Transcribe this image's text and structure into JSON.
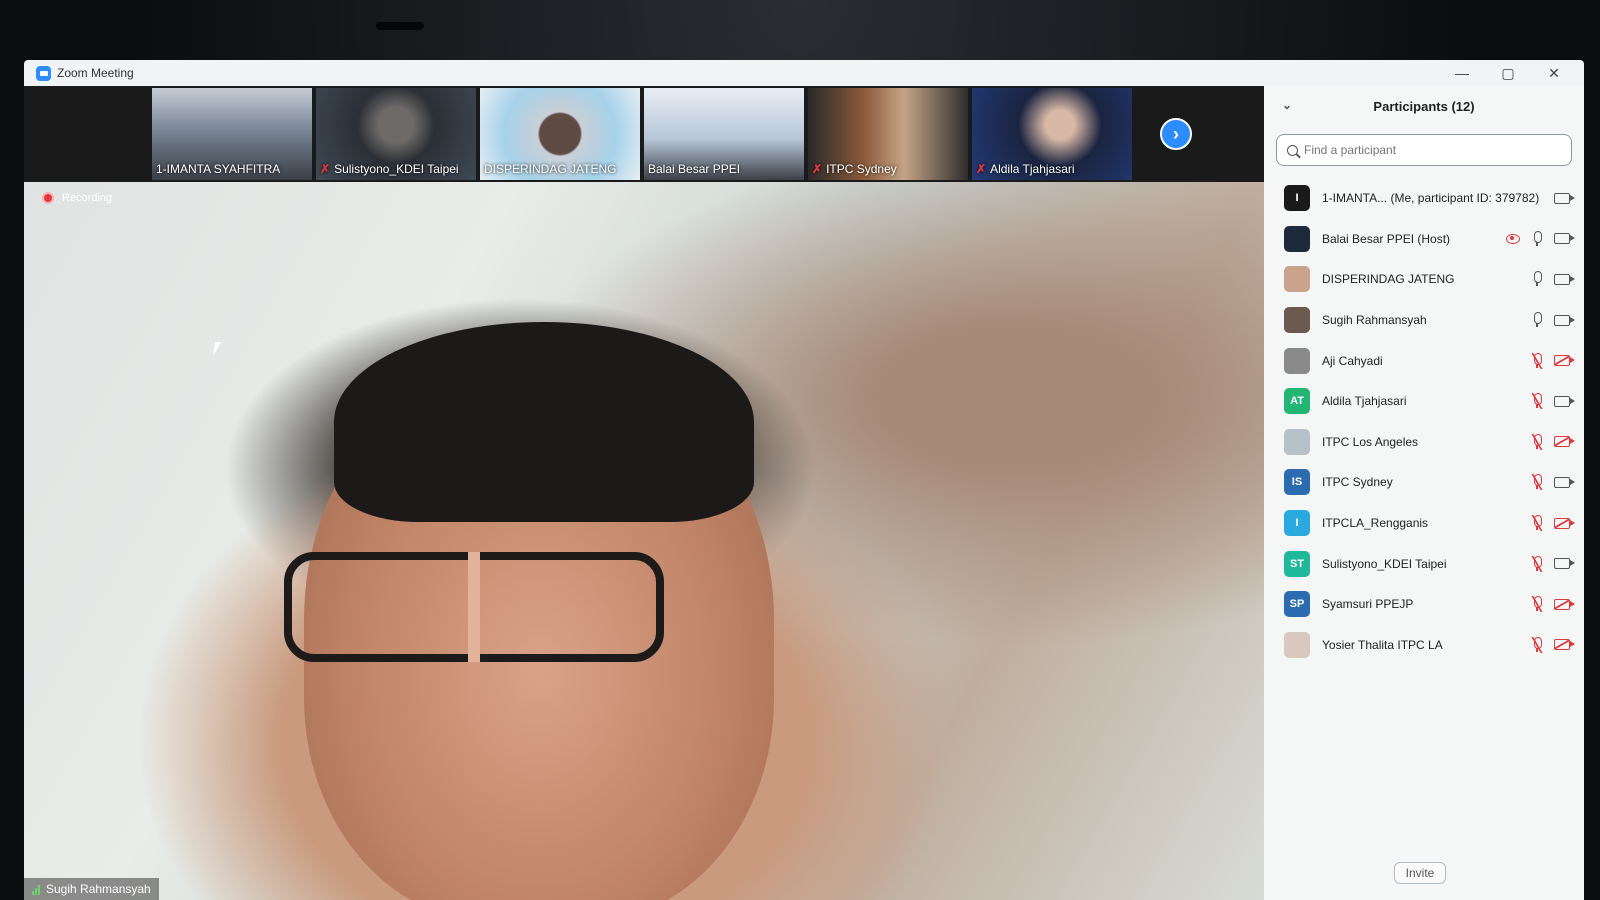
{
  "window": {
    "title": "Zoom Meeting",
    "minimize": "—",
    "maximize": "▢",
    "close": "✕"
  },
  "thumbnails": [
    {
      "name": "1-IMANTA SYAHFITRA",
      "muted": false
    },
    {
      "name": "Sulistyono_KDEI Taipei",
      "muted": true
    },
    {
      "name": "DISPERINDAG JATENG",
      "muted": false
    },
    {
      "name": "Balai Besar PPEI",
      "muted": false
    },
    {
      "name": "ITPC Sydney",
      "muted": true
    },
    {
      "name": "Aldila Tjahjasari",
      "muted": true
    }
  ],
  "strip_next_glyph": "›",
  "recording_label": "Recording",
  "active_speaker": "Sugih Rahmansyah",
  "participants_panel": {
    "title": "Participants (12)",
    "search_placeholder": "Find a participant",
    "invite_label": "Invite",
    "participants": [
      {
        "name": "1-IMANTA... (Me, participant ID: 379782)",
        "avatar": "I",
        "avatar_color": "#1a1a1a",
        "mic": "none",
        "camera": "on"
      },
      {
        "name": "Balai Besar PPEI (Host)",
        "avatar": "",
        "avatar_color": "#1d2a3a",
        "mic": "on",
        "camera": "on",
        "sharing": true
      },
      {
        "name": "DISPERINDAG JATENG",
        "avatar": "",
        "avatar_color": "#c9a38c",
        "mic": "on",
        "camera": "on"
      },
      {
        "name": "Sugih Rahmansyah",
        "avatar": "",
        "avatar_color": "#6a5a50",
        "mic": "on",
        "camera": "on"
      },
      {
        "name": "Aji Cahyadi",
        "avatar": "",
        "avatar_color": "#8a8a8a",
        "mic": "muted",
        "camera": "off"
      },
      {
        "name": "Aldila Tjahjasari",
        "avatar": "AT",
        "avatar_color": "#22b573",
        "mic": "muted",
        "camera": "on"
      },
      {
        "name": "ITPC Los Angeles",
        "avatar": "",
        "avatar_color": "#b8c0c8",
        "mic": "muted",
        "camera": "off"
      },
      {
        "name": "ITPC Sydney",
        "avatar": "IS",
        "avatar_color": "#2b6cb0",
        "mic": "muted",
        "camera": "on"
      },
      {
        "name": "ITPCLA_Rengganis",
        "avatar": "I",
        "avatar_color": "#2aa9e0",
        "mic": "muted",
        "camera": "off"
      },
      {
        "name": "Sulistyono_KDEI Taipei",
        "avatar": "ST",
        "avatar_color": "#1fb89a",
        "mic": "muted",
        "camera": "on"
      },
      {
        "name": "Syamsuri PPEJP",
        "avatar": "SP",
        "avatar_color": "#2b6cb0",
        "mic": "muted",
        "camera": "off"
      },
      {
        "name": "Yosier Thalita ITPC LA",
        "avatar": "",
        "avatar_color": "#d8c8c0",
        "mic": "muted",
        "camera": "off"
      }
    ]
  },
  "colors": {
    "accent": "#2d8cff",
    "muted_red": "#e0383e",
    "panel_bg": "#f5f7f6"
  }
}
